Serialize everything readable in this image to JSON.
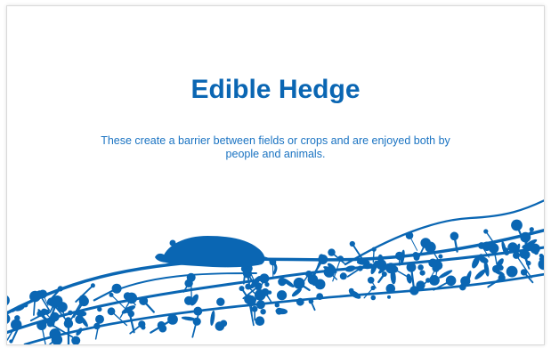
{
  "slide": {
    "title": "Edible Hedge",
    "description": "These create a barrier between fields or crops and are enjoyed both by people and animals."
  },
  "colors": {
    "accent": "#0a66b3",
    "text": "#1a73c2",
    "background": "#ffffff"
  },
  "illustration": {
    "subject": "hedge-branches-with-berries-and-animal"
  }
}
